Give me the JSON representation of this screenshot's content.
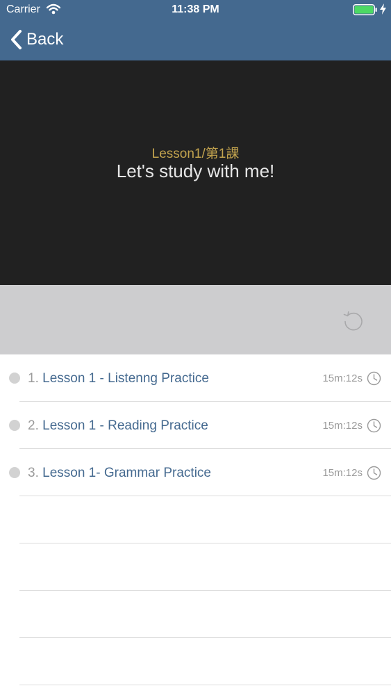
{
  "status_bar": {
    "carrier": "Carrier",
    "time": "11:38 PM",
    "icons": [
      "wifi-icon",
      "battery-icon",
      "charging-icon"
    ]
  },
  "nav": {
    "back_label": "Back",
    "back_icon": "chevron-left-icon"
  },
  "video": {
    "subtitle": "Lesson1/第1課",
    "title": "Let's study with me!"
  },
  "controls": {
    "replay_icon": "replay-icon"
  },
  "lessons": [
    {
      "index": "1.",
      "title": "Lesson 1 - Listenng Practice",
      "duration": "15m:12s"
    },
    {
      "index": "2.",
      "title": "Lesson 1 - Reading Practice",
      "duration": "15m:12s"
    },
    {
      "index": "3.",
      "title": "Lesson 1- Grammar Practice",
      "duration": "15m:12s"
    }
  ],
  "colors": {
    "nav_background": "#44698f",
    "video_background": "#212121",
    "subtitle": "#c2a34e",
    "controls_background": "#cdcdcf",
    "link_text": "#44698f",
    "battery": "#4cd964"
  }
}
